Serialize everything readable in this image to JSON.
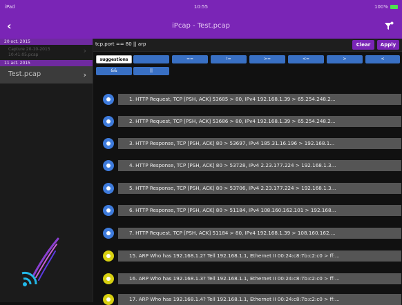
{
  "status_bar": {
    "left": "iPad",
    "time": "10:55",
    "right": "100%"
  },
  "nav": {
    "title": "iPcap - Test.pcap"
  },
  "sidebar": {
    "sections": [
      {
        "date": "20 oct. 2015",
        "items": [
          {
            "name": "Capture 20-10-2015 10:41:05.pcap",
            "line1": "Capture 20-10-2015",
            "line2": "10:41:05.pcap",
            "selected": false
          }
        ]
      },
      {
        "date": "11 act. 2015",
        "items": [
          {
            "name": "Test.pcap",
            "selected": true
          }
        ]
      }
    ]
  },
  "filter": {
    "query": "tcp.port == 80 || arp",
    "clear_label": "Clear",
    "apply_label": "Apply"
  },
  "suggestions": {
    "row1": [
      "suggestions",
      "",
      "==",
      "!=",
      ">=",
      "<=",
      ">",
      "<"
    ],
    "row2": [
      "&&",
      "||"
    ]
  },
  "packets": [
    {
      "type": "tcp",
      "text": "1.  HTTP Request, TCP [PSH, ACK] 53685 > 80, IPv4 192.168.1.39 > 65.254.248.2..."
    },
    {
      "type": "tcp",
      "text": "2.  HTTP Request, TCP [PSH, ACK] 53686 > 80, IPv4 192.168.1.39 > 65.254.248.2..."
    },
    {
      "type": "tcp",
      "text": "3.  HTTP Response, TCP [PSH, ACK] 80 > 53697, IPv4 185.31.16.196 > 192.168.1..."
    },
    {
      "type": "tcp",
      "text": "4.  HTTP Response, TCP [PSH, ACK] 80 > 53728, IPv4 2.23.177.224 > 192.168.1.3..."
    },
    {
      "type": "tcp",
      "text": "5.  HTTP Response, TCP [PSH, ACK] 80 > 53706, IPv4 2.23.177.224 > 192.168.1.3..."
    },
    {
      "type": "tcp",
      "text": "6.  HTTP Response, TCP [PSH, ACK] 80 > 51184, IPv4 108.160.162.101 > 192.168..."
    },
    {
      "type": "tcp",
      "text": "7.  HTTP Request, TCP [PSH, ACK] 51184 > 80, IPv4 192.168.1.39 > 108.160.162...."
    },
    {
      "type": "arp",
      "text": "15.  ARP Who has 192.168.1.2? Tell 192.168.1.1, Ethernet II 00:24:c8:7b:c2:c0 > ff:..."
    },
    {
      "type": "arp",
      "text": "16.  ARP Who has 192.168.1.3? Tell 192.168.1.1, Ethernet II 00:24:c8:7b:c2:c0 > ff:..."
    },
    {
      "type": "arp",
      "text": "17.  ARP Who has 192.168.1.4? Tell 192.168.1.1, Ethernet II 00:24:c8:7b:c2:c0 > ff:..."
    }
  ],
  "colors": {
    "accent": "#7a25b6",
    "tcp_dot": "#3e7bdc",
    "arp_dot": "#d7d010",
    "row_bg": "#555555",
    "suggest_btn": "#3970c4"
  }
}
